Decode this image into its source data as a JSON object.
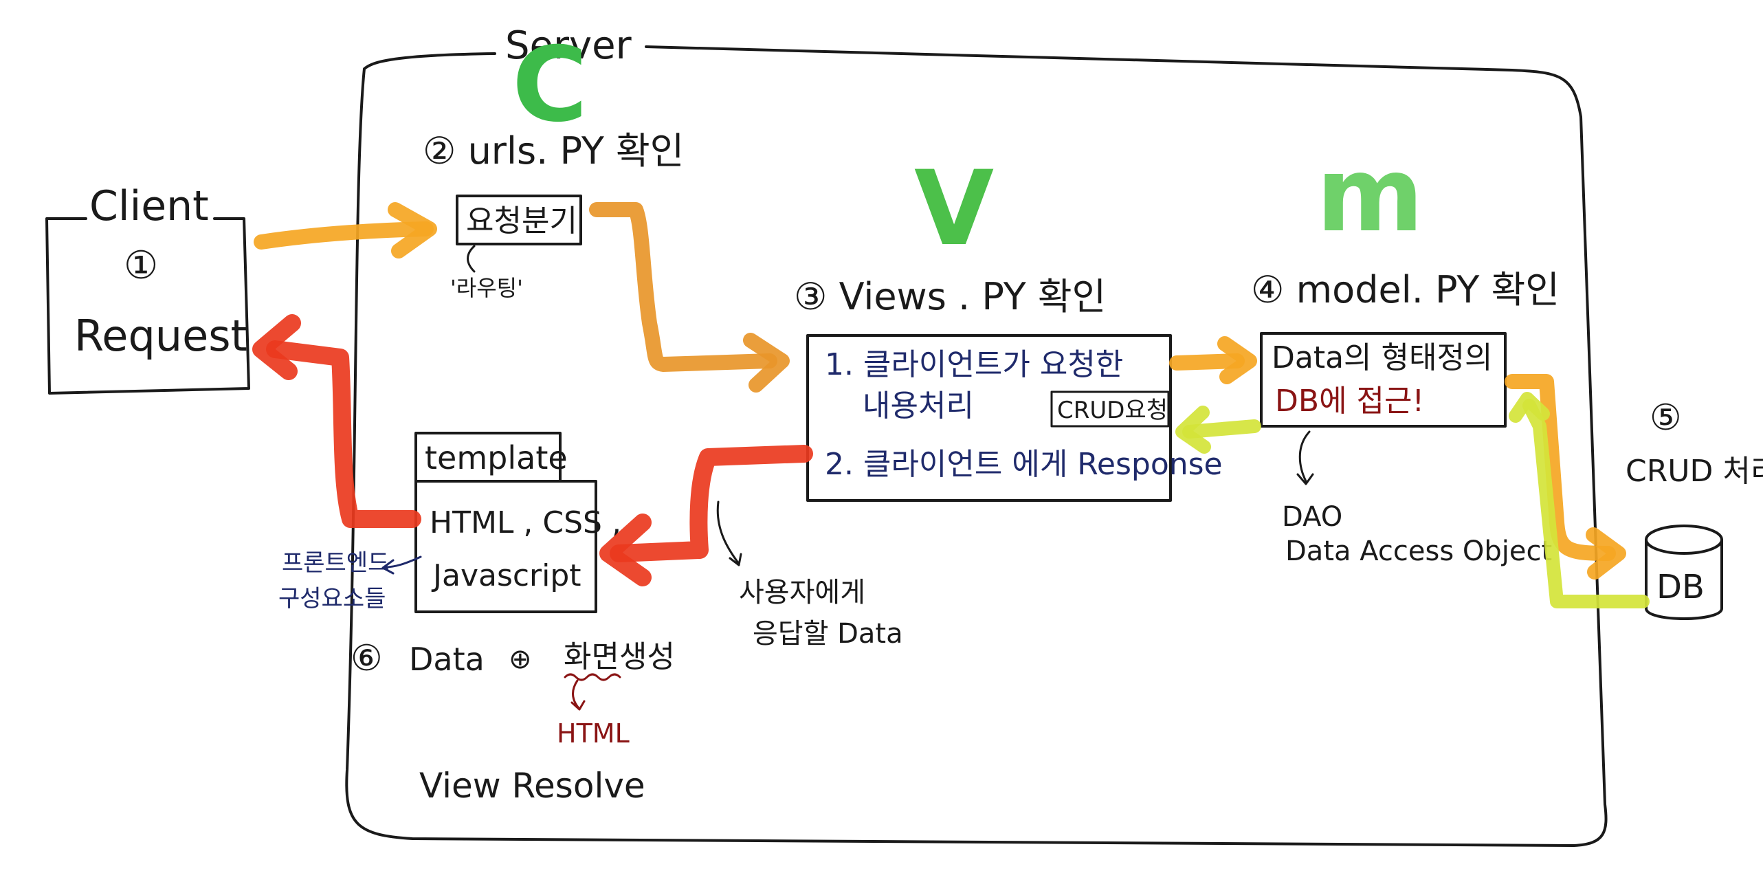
{
  "server_label": "Server",
  "mvc_letters": {
    "controller": "C",
    "view": "V",
    "model": "m"
  },
  "client": {
    "title": "Client",
    "step": "①",
    "label": "Request"
  },
  "step2": {
    "heading": "② urls. PY 확인",
    "box": "요청분기",
    "note": "'라우팅'"
  },
  "step3": {
    "heading": "③ Views . PY 확인",
    "line1a": "1. 클라이언트가 요청한",
    "line1b": "내용처리",
    "crud_tag": "CRUD요청",
    "line2": "2. 클라이언트 에게 Response",
    "note_line1": "사용자에게",
    "note_line2": "응답할 Data"
  },
  "step4": {
    "heading": "④ model. PY 확인",
    "line1": "Data의 형태정의",
    "line2": "DB에 접근!",
    "dao": "DAO",
    "dao_full": "Data Access Object"
  },
  "step5": {
    "step": "⑤",
    "label": "CRUD 처리",
    "db": "DB"
  },
  "template": {
    "tab": "template",
    "line1": "HTML , CSS ,",
    "line2": "Javascript",
    "note_line1": "프론트엔드",
    "note_line2": "구성요소들"
  },
  "step6": {
    "step": "⑥",
    "data": "Data",
    "plus": "⊕",
    "create": "화면생성",
    "html": "HTML",
    "resolve": "View Resolve"
  },
  "colors": {
    "controller_green": "#3dbb4a",
    "view_green": "#4cc04a",
    "model_green": "#6fd16a",
    "arrow_orange": "#f5a623",
    "arrow_red": "#ea3a1e",
    "arrow_yellowgreen": "#d4e43a",
    "ink_blue": "#1f2a6b",
    "ink_red": "#8a1414"
  }
}
